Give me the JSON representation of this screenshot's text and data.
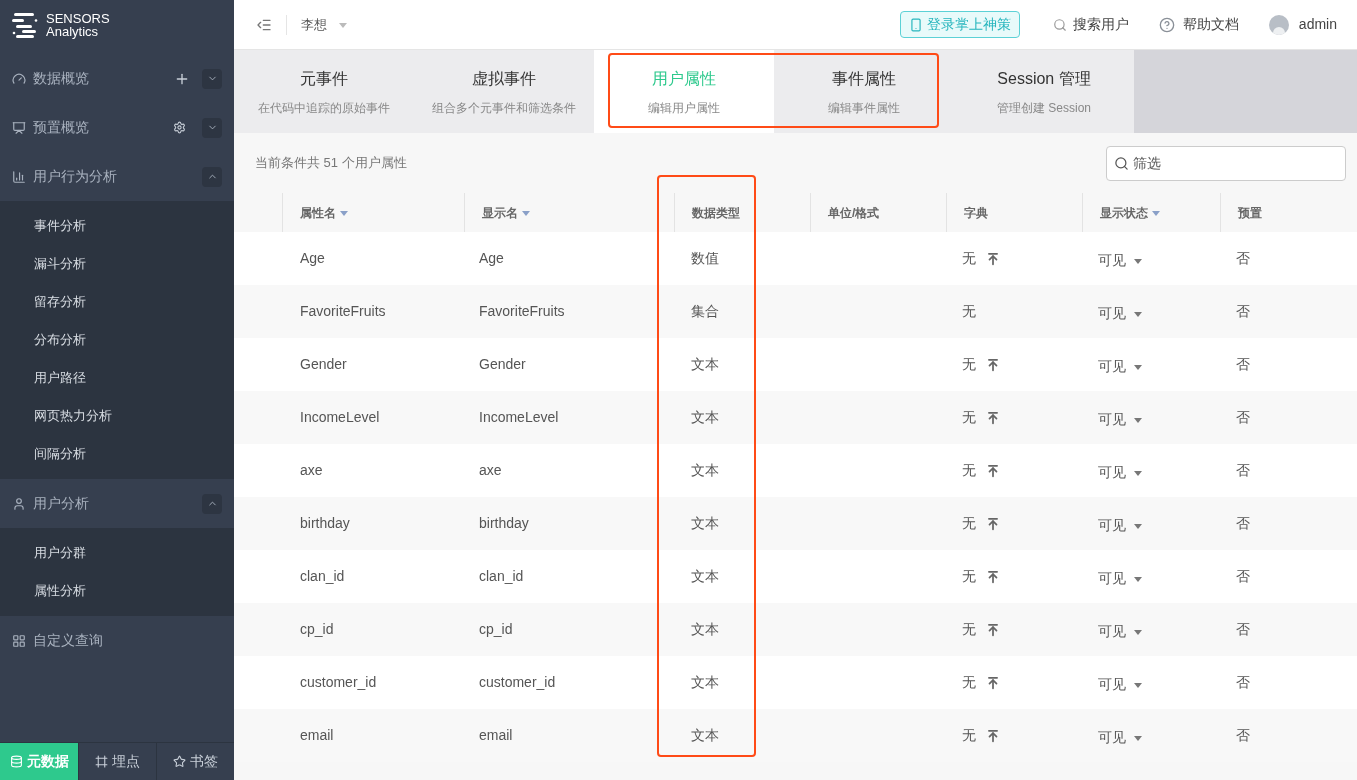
{
  "logo": {
    "line1": "SENSORS",
    "line2": "Analytics"
  },
  "sidebar": {
    "items": [
      {
        "label": "数据概览",
        "expanded": false
      },
      {
        "label": "预置概览",
        "expanded": false
      },
      {
        "label": "用户行为分析",
        "expanded": true,
        "children": [
          {
            "label": "事件分析"
          },
          {
            "label": "漏斗分析"
          },
          {
            "label": "留存分析"
          },
          {
            "label": "分布分析"
          },
          {
            "label": "用户路径"
          },
          {
            "label": "网页热力分析"
          },
          {
            "label": "间隔分析"
          }
        ]
      },
      {
        "label": "用户分析",
        "expanded": true,
        "children": [
          {
            "label": "用户分群"
          },
          {
            "label": "属性分析"
          }
        ]
      },
      {
        "label": "自定义查询"
      }
    ],
    "bottom_tabs": [
      {
        "label": "元数据",
        "selected": true
      },
      {
        "label": "埋点",
        "selected": false
      },
      {
        "label": "书签",
        "selected": false
      }
    ]
  },
  "header": {
    "project": "李想",
    "login_button": "登录掌上神策",
    "search_users": "搜索用户",
    "help": "帮助文档",
    "user": "admin"
  },
  "tabs": [
    {
      "title": "元事件",
      "subtitle": "在代码中追踪的原始事件",
      "selected": false
    },
    {
      "title": "虚拟事件",
      "subtitle": "组合多个元事件和筛选条件",
      "selected": false
    },
    {
      "title": "用户属性",
      "subtitle": "编辑用户属性",
      "selected": true
    },
    {
      "title": "事件属性",
      "subtitle": "编辑事件属性",
      "selected": false
    },
    {
      "title": "Session 管理",
      "subtitle": "管理创建 Session",
      "selected": false
    }
  ],
  "count_text": "当前条件共 51 个用户属性",
  "filter": {
    "placeholder": "筛选"
  },
  "table": {
    "columns": [
      {
        "label": "属性名",
        "sortable": true
      },
      {
        "label": "显示名",
        "sortable": true
      },
      {
        "label": "数据类型",
        "sortable": false
      },
      {
        "label": "单位/格式",
        "sortable": false
      },
      {
        "label": "字典",
        "sortable": false
      },
      {
        "label": "显示状态",
        "sortable": true
      },
      {
        "label": "预置",
        "sortable": false
      }
    ],
    "rows": [
      {
        "name": "Age",
        "display": "Age",
        "type": "数值",
        "dict": "无",
        "uploadable": true,
        "status": "可见",
        "preset": "否"
      },
      {
        "name": "FavoriteFruits",
        "display": "FavoriteFruits",
        "type": "集合",
        "dict": "无",
        "uploadable": false,
        "status": "可见",
        "preset": "否"
      },
      {
        "name": "Gender",
        "display": "Gender",
        "type": "文本",
        "dict": "无",
        "uploadable": true,
        "status": "可见",
        "preset": "否"
      },
      {
        "name": "IncomeLevel",
        "display": "IncomeLevel",
        "type": "文本",
        "dict": "无",
        "uploadable": true,
        "status": "可见",
        "preset": "否"
      },
      {
        "name": "axe",
        "display": "axe",
        "type": "文本",
        "dict": "无",
        "uploadable": true,
        "status": "可见",
        "preset": "否"
      },
      {
        "name": "birthday",
        "display": "birthday",
        "type": "文本",
        "dict": "无",
        "uploadable": true,
        "status": "可见",
        "preset": "否"
      },
      {
        "name": "clan_id",
        "display": "clan_id",
        "type": "文本",
        "dict": "无",
        "uploadable": true,
        "status": "可见",
        "preset": "否"
      },
      {
        "name": "cp_id",
        "display": "cp_id",
        "type": "文本",
        "dict": "无",
        "uploadable": true,
        "status": "可见",
        "preset": "否"
      },
      {
        "name": "customer_id",
        "display": "customer_id",
        "type": "文本",
        "dict": "无",
        "uploadable": true,
        "status": "可见",
        "preset": "否"
      },
      {
        "name": "email",
        "display": "email",
        "type": "文本",
        "dict": "无",
        "uploadable": true,
        "status": "可见",
        "preset": "否"
      }
    ]
  }
}
